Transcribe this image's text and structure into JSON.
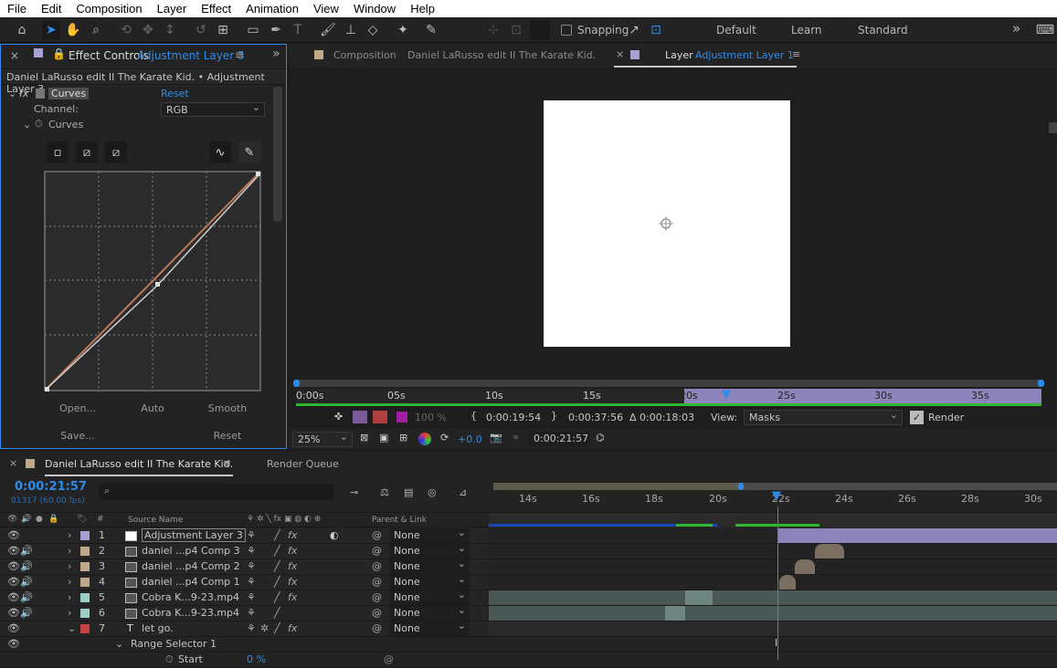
{
  "menu": [
    "File",
    "Edit",
    "Composition",
    "Layer",
    "Effect",
    "Animation",
    "View",
    "Window",
    "Help"
  ],
  "toolbar": {
    "snapping": "Snapping",
    "workspaces": [
      "Default",
      "Learn",
      "Standard"
    ],
    "more": "»"
  },
  "effect_controls": {
    "tab_prefix": "Effect Controls",
    "tab_layer": "Adjustment Layer 3",
    "breadcrumb": "Daniel LaRusso edit II The Karate Kid. • Adjustment Layer 3",
    "effect_name": "Curves",
    "reset": "Reset",
    "channel_label": "Channel:",
    "channel_value": "RGB",
    "curves_label": "Curves",
    "footer": [
      "Open...",
      "Auto",
      "Smooth",
      "Save...",
      "Reset"
    ]
  },
  "viewer": {
    "comp_tab_prefix": "Composition",
    "comp_tab_name": "Daniel LaRusso edit II The Karate Kid.",
    "layer_tab_prefix": "Layer",
    "layer_tab_name": "Adjustment Layer 1",
    "ruler": [
      "0:00s",
      "05s",
      "10s",
      "15s",
      "20s",
      "25s",
      "30s",
      "35s"
    ],
    "opacity": "100 %",
    "in_time": "0:00:19:54",
    "out_time": "0:00:37:56",
    "duration": "Δ 0:00:18:03",
    "view_label": "View:",
    "view_value": "Masks",
    "render_label": "Render",
    "zoom": "25%",
    "exposure": "+0.0",
    "current_time": "0:00:21:57"
  },
  "timeline": {
    "tab_name": "Daniel LaRusso edit II The Karate Kid.",
    "render_queue": "Render Queue",
    "timecode": "0:00:21:57",
    "frame_info": "01317 (60.00 fps)",
    "search_placeholder": "",
    "col_num": "#",
    "col_source": "Source Name",
    "col_parent": "Parent & Link",
    "ruler": [
      "14s",
      "16s",
      "18s",
      "20s",
      "22s",
      "24s",
      "26s",
      "28s",
      "30s"
    ],
    "layers": [
      {
        "num": "1",
        "name": "Adjustment Layer 3",
        "parent": "None",
        "color": "#a7a1d3"
      },
      {
        "num": "2",
        "name": "daniel ...p4 Comp 3",
        "parent": "None",
        "color": "#c0a98a"
      },
      {
        "num": "3",
        "name": "daniel ...p4 Comp 2",
        "parent": "None",
        "color": "#c0a98a"
      },
      {
        "num": "4",
        "name": "daniel ...p4 Comp 1",
        "parent": "None",
        "color": "#c0a98a"
      },
      {
        "num": "5",
        "name": "Cobra K...9-23.mp4",
        "parent": "None",
        "color": "#9fd0c8"
      },
      {
        "num": "6",
        "name": "Cobra K...9-23.mp4",
        "parent": "None",
        "color": "#9fd0c8"
      },
      {
        "num": "7",
        "name": "let go.",
        "parent": "None",
        "color": "#c84343"
      }
    ],
    "range_selector": "Range Selector 1",
    "start_label": "Start",
    "start_value": "0 %"
  },
  "colors": {
    "accent": "#2d8ceb",
    "panel": "#232323",
    "menubar": "#ffffff"
  }
}
